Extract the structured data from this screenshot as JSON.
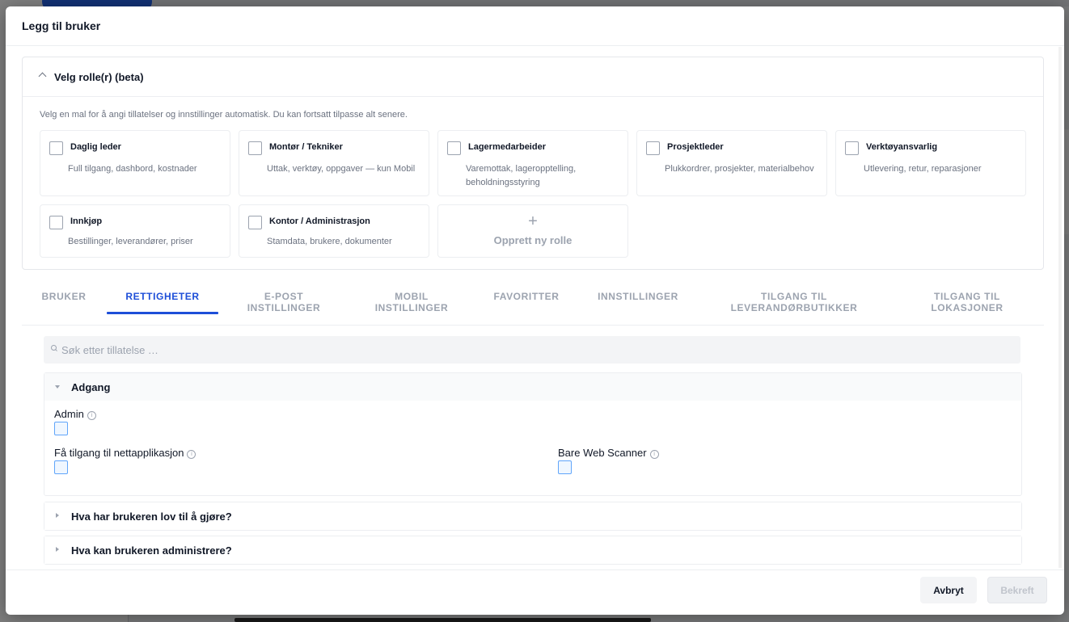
{
  "dialog": {
    "title": "Legg til bruker"
  },
  "roles": {
    "section_title": "Velg rolle(r) (beta)",
    "description": "Velg en mal for å angi tillatelser og innstillinger automatisk. Du kan fortsatt tilpasse alt senere.",
    "items": [
      {
        "name": "Daglig leder",
        "description": "Full tilgang, dashbord, kostnader",
        "checked": false
      },
      {
        "name": "Montør / Tekniker",
        "description": "Uttak, verktøy, oppgaver — kun Mobil",
        "checked": false
      },
      {
        "name": "Lagermedarbeider",
        "description": "Varemottak, lageropptelling, beholdningsstyring",
        "checked": false
      },
      {
        "name": "Prosjektleder",
        "description": "Plukkordrer, prosjekter, materialbehov",
        "checked": false
      },
      {
        "name": "Verktøyansvarlig",
        "description": "Utlevering, retur, reparasjoner",
        "checked": false
      },
      {
        "name": "Innkjøp",
        "description": "Bestillinger, leverandører, priser",
        "checked": false
      },
      {
        "name": "Kontor / Administrasjon",
        "description": "Stamdata, brukere, dokumenter",
        "checked": false
      }
    ],
    "create_new_label": "Opprett ny rolle",
    "create_new_icon": "plus-icon"
  },
  "tabs": [
    {
      "label": "BRUKER",
      "active": false
    },
    {
      "label": "RETTIGHETER",
      "active": true
    },
    {
      "label": "E-POST INSTILLINGER",
      "active": false
    },
    {
      "label": "MOBIL INSTILLINGER",
      "active": false
    },
    {
      "label": "FAVORITTER",
      "active": false
    },
    {
      "label": "INNSTILLINGER",
      "active": false
    },
    {
      "label": "TILGANG TIL LEVERANDØRBUTIKKER",
      "active": false
    },
    {
      "label": "TILGANG TIL LOKASJONER",
      "active": false
    }
  ],
  "search": {
    "placeholder": "Søk etter tillatelse …",
    "value": ""
  },
  "permissions": {
    "groups": [
      {
        "title": "Adgang",
        "expanded": true,
        "items": [
          {
            "label": "Admin",
            "checked": false
          },
          {
            "label": "Få tilgang til nettapplikasjon",
            "checked": false
          },
          {
            "label": "Bare Web Scanner",
            "checked": false
          }
        ]
      },
      {
        "title": "Hva har brukeren lov til å gjøre?",
        "expanded": false
      },
      {
        "title": "Hva kan brukeren administrere?",
        "expanded": false
      }
    ]
  },
  "footer": {
    "cancel_label": "Avbryt",
    "confirm_label": "Bekreft",
    "confirm_enabled": false
  },
  "colors": {
    "accent": "#1d4ed8",
    "checkbox_border": "#60a5fa",
    "muted_text": "#9ca3af"
  }
}
